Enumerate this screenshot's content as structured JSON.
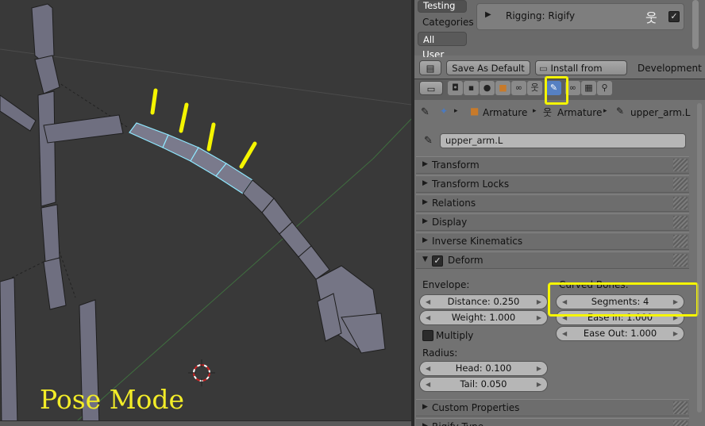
{
  "viewport": {
    "mode_label": "Pose Mode"
  },
  "addons": {
    "tab_testing": "Testing",
    "categories_label": "Categories",
    "category_all": "All",
    "category_user": "User",
    "addon_name": "Rigging: Rigify",
    "addon_enabled": "✓"
  },
  "toolbar": {
    "save_default": "Save As Default",
    "install_file": "Install from File...",
    "dev_guide": "Development Gu"
  },
  "breadcrumb": {
    "item1": "Armature",
    "item2": "Armature",
    "item3": "upper_arm.L"
  },
  "bone_name": "upper_arm.L",
  "panels": {
    "transform": "Transform",
    "transform_locks": "Transform Locks",
    "relations": "Relations",
    "display": "Display",
    "inverse_kinematics": "Inverse Kinematics",
    "deform": "Deform",
    "custom_properties": "Custom Properties",
    "rigify_type": "Rigify Type"
  },
  "deform": {
    "envelope_label": "Envelope:",
    "distance": "Distance: 0.250",
    "weight": "Weight: 1.000",
    "multiply": "Multiply",
    "radius_label": "Radius:",
    "head": "Head: 0.100",
    "tail": "Tail: 0.050",
    "curved_label": "Curved Bones:",
    "segments": "Segments: 4",
    "ease_in": "Ease In: 1.000",
    "ease_out": "Ease Out: 1.000"
  },
  "colors": {
    "highlight": "#f5f500",
    "selected_bone": "#7fe0ff",
    "active_tab": "#5680c2"
  }
}
